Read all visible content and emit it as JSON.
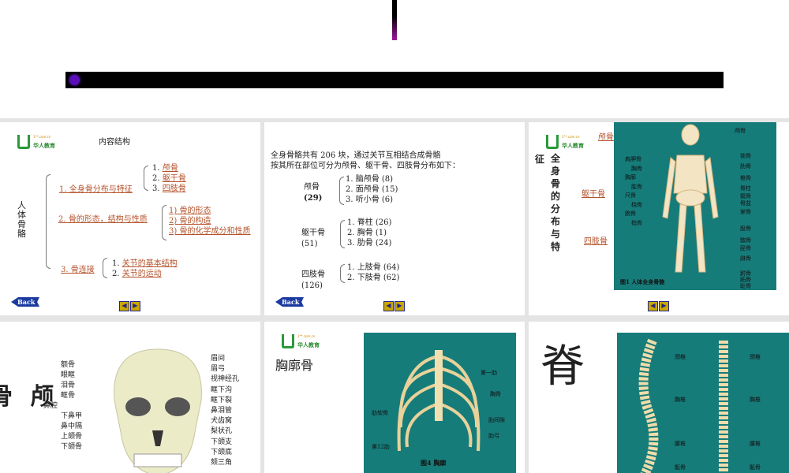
{
  "slide1": {
    "title": "内容结构",
    "root": "人体骨骼",
    "sec1": "1. 全身骨分布与特征",
    "sec1_items": [
      "1. ",
      "颅骨",
      "2. ",
      "躯干骨",
      "3. ",
      "四肢骨"
    ],
    "sec2": "2. 骨的形态，结构与性质",
    "sec2_items": [
      "1) 骨的形态",
      "2) 骨的构造",
      "3) 骨的化学成分和性质"
    ],
    "sec3": "3. 骨连接",
    "sec3_items": [
      "1. ",
      "关节的基本结构",
      "2. ",
      "关节的运动"
    ],
    "back": "Back"
  },
  "slide2": {
    "intro1": "全身骨骼共有 206 块，通过关节互相结合成骨骼",
    "intro2": "按其所在部位可分为颅骨、躯干骨、四肢骨分布如下：",
    "groups": [
      {
        "name": "颅骨",
        "count": "(29)",
        "items": [
          "1. 脑颅骨 (8)",
          "2. 面颅骨 (15)",
          "3. 听小骨 (6)"
        ]
      },
      {
        "name": "躯干骨",
        "count": "(51)",
        "items": [
          "1. 脊柱 (26)",
          "2. 胸骨 (1)",
          "3. 肋骨 (24)"
        ]
      },
      {
        "name": "四肢骨",
        "count": "(126)",
        "items": [
          "1. 上肢骨 (64)",
          "2. 下肢骨 (62)"
        ]
      }
    ],
    "back": "Back"
  },
  "slide3": {
    "title_v": "全身骨的分布与特",
    "title_extra": "征",
    "links": [
      "颅骨",
      "躯干骨",
      "四肢骨"
    ],
    "left_labels": [
      "肩胛骨",
      "胸骨",
      "胸廓",
      "肱骨",
      "尺骨",
      "桡骨",
      "腕骨",
      "指骨"
    ],
    "right_labels": [
      "颅骨",
      "锁骨",
      "肋骨",
      "椎骨",
      "脊柱",
      "髋骨",
      "骨盆",
      "掌骨",
      "股骨",
      "髌骨",
      "胫骨",
      "腓骨",
      "跗骨",
      "跖骨",
      "趾骨"
    ],
    "caption": "图1  人体全身骨骼"
  },
  "slide4": {
    "title": "骨 颅",
    "left_labels": [
      "额骨",
      "眼眶",
      "泪骨",
      "眶骨",
      "鼻腔",
      "下鼻甲",
      "鼻中隔",
      "上颌骨",
      "下颌骨"
    ],
    "right_labels": [
      "眉间",
      "眉弓",
      "视神经孔",
      "眶下沟",
      "眶下裂",
      "鼻泪管",
      "犬齿窝",
      "梨状孔",
      "下颌支",
      "下颌底",
      "颏三角"
    ]
  },
  "slide5": {
    "title": "胸廓骨",
    "labels_right": [
      "第一肋",
      "胸骨",
      "肋间隙",
      "肋弓"
    ],
    "labels_left": [
      "肋软骨",
      "第12肋"
    ],
    "caption": "图4  胸廓"
  },
  "slide6": {
    "title": "脊",
    "labels": [
      "颈椎",
      "胸椎",
      "腰椎",
      "骶骨"
    ]
  },
  "logo": {
    "url": "1**.com.cn",
    "name": "华人教育"
  }
}
